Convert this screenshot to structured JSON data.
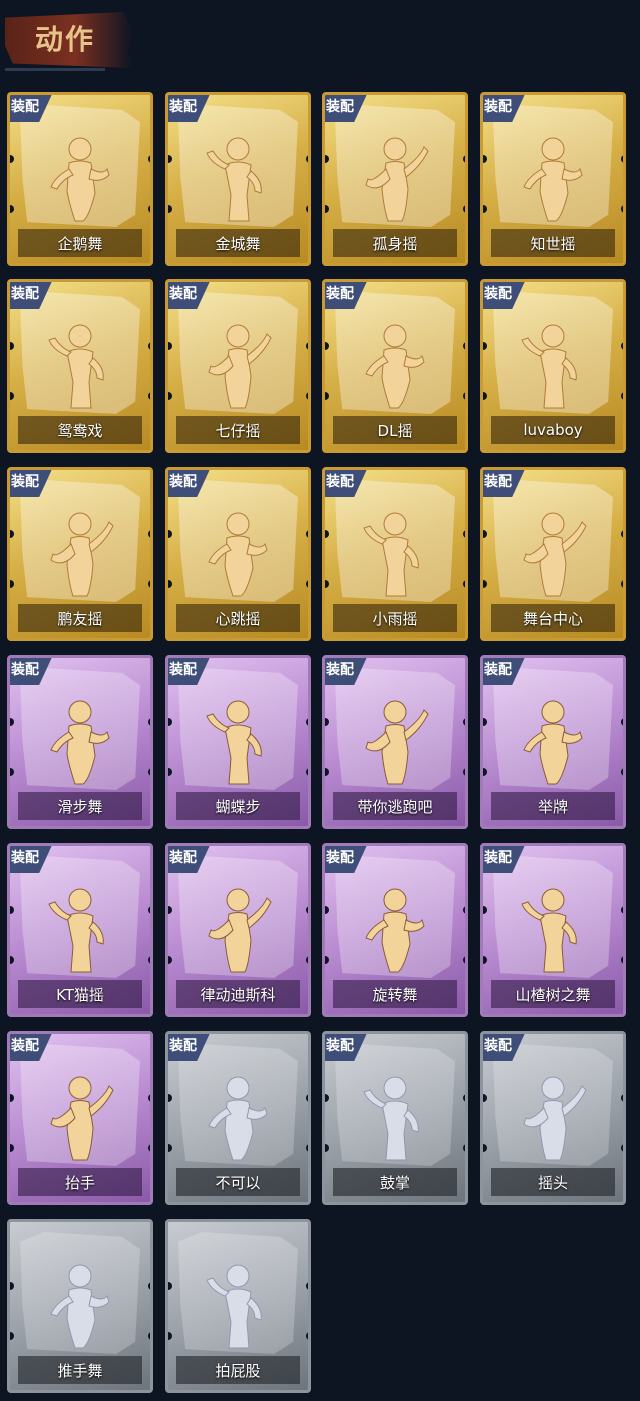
{
  "header": {
    "title": "动作"
  },
  "equip_label": "装配",
  "cards": [
    {
      "name": "企鹅舞",
      "tier": "gold",
      "equipped": true
    },
    {
      "name": "金城舞",
      "tier": "gold",
      "equipped": true
    },
    {
      "name": "孤身摇",
      "tier": "gold",
      "equipped": true
    },
    {
      "name": "知世摇",
      "tier": "gold",
      "equipped": true
    },
    {
      "name": "鸳鸯戏",
      "tier": "gold",
      "equipped": true
    },
    {
      "name": "七仔摇",
      "tier": "gold",
      "equipped": true
    },
    {
      "name": "DL摇",
      "tier": "gold",
      "equipped": true
    },
    {
      "name": "luvaboy",
      "tier": "gold",
      "equipped": true
    },
    {
      "name": "鹏友摇",
      "tier": "gold",
      "equipped": true
    },
    {
      "name": "心跳摇",
      "tier": "gold",
      "equipped": true
    },
    {
      "name": "小雨摇",
      "tier": "gold",
      "equipped": true
    },
    {
      "name": "舞台中心",
      "tier": "gold",
      "equipped": true
    },
    {
      "name": "滑步舞",
      "tier": "purple",
      "equipped": true
    },
    {
      "name": "蝴蝶步",
      "tier": "purple",
      "equipped": true
    },
    {
      "name": "带你逃跑吧",
      "tier": "purple",
      "equipped": true
    },
    {
      "name": "举牌",
      "tier": "purple",
      "equipped": true
    },
    {
      "name": "KT猫摇",
      "tier": "purple",
      "equipped": true
    },
    {
      "name": "律动迪斯科",
      "tier": "purple",
      "equipped": true
    },
    {
      "name": "旋转舞",
      "tier": "purple",
      "equipped": true
    },
    {
      "name": "山楂树之舞",
      "tier": "purple",
      "equipped": true
    },
    {
      "name": "抬手",
      "tier": "purple",
      "equipped": true
    },
    {
      "name": "不可以",
      "tier": "gray",
      "equipped": true
    },
    {
      "name": "鼓掌",
      "tier": "gray",
      "equipped": true
    },
    {
      "name": "摇头",
      "tier": "gray",
      "equipped": true
    },
    {
      "name": "推手舞",
      "tier": "gray",
      "equipped": false
    },
    {
      "name": "拍屁股",
      "tier": "gray",
      "equipped": false
    }
  ],
  "colors": {
    "background": "#0d1422",
    "gold": "#d7b048",
    "purple": "#b88ad0",
    "gray": "#9ca2aa",
    "equip_tag": "#3e4e78"
  }
}
